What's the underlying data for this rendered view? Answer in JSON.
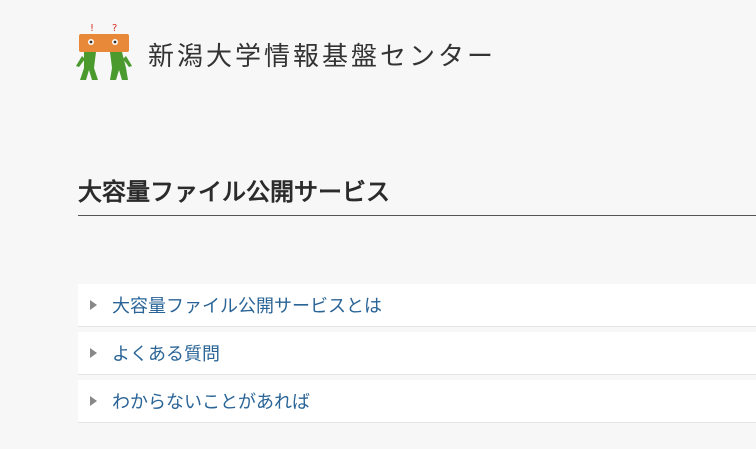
{
  "header": {
    "site_name": "新潟大学情報基盤センター",
    "logo_icon": "mascot-logo"
  },
  "page": {
    "title": "大容量ファイル公開サービス"
  },
  "menu": {
    "items": [
      {
        "label": "大容量ファイル公開サービスとは",
        "icon": "triangle-right-icon"
      },
      {
        "label": "よくある質問",
        "icon": "triangle-right-icon"
      },
      {
        "label": "わからないことがあれば",
        "icon": "triangle-right-icon"
      }
    ]
  },
  "colors": {
    "background": "#f7f7f7",
    "link": "#2a6496",
    "logo_orange": "#e8893a",
    "logo_green": "#4a9a2e",
    "logo_red": "#d8332a"
  }
}
